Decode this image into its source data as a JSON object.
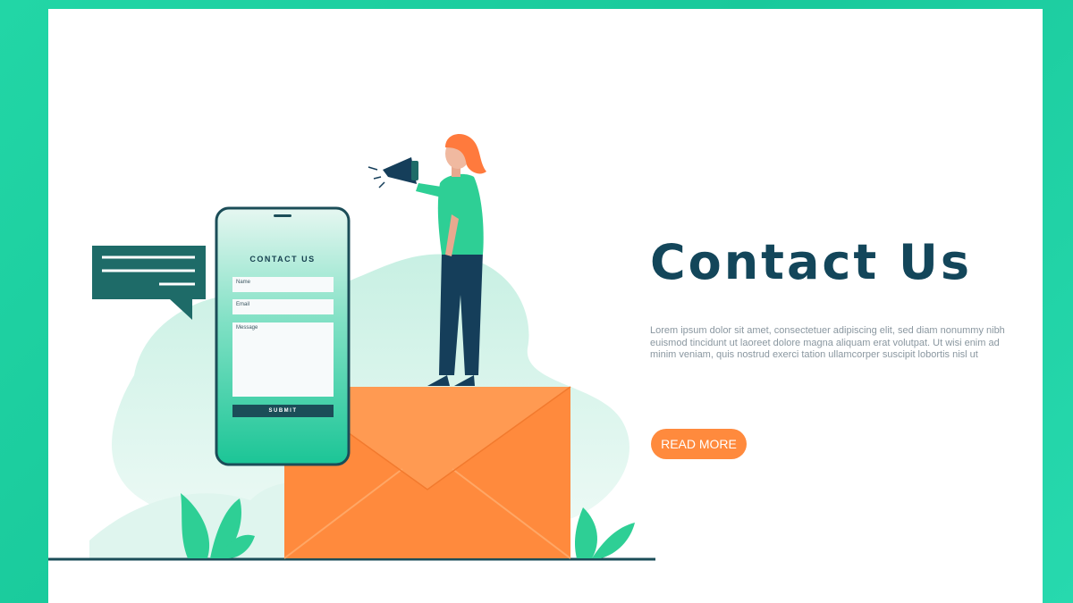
{
  "colors": {
    "frame": "#1fd3a4",
    "heading": "#13465a",
    "accent_orange": "#ff8a3d",
    "phone_gradient_top": "#dff5ee",
    "phone_gradient_bottom": "#1fc89b",
    "dark_teal": "#1b4d58",
    "leaf_green": "#2ecf95"
  },
  "phone": {
    "title": "CONTACT US",
    "name_placeholder": "Name",
    "email_placeholder": "Email",
    "message_placeholder": "Message",
    "submit_label": "SUBMIT"
  },
  "hero": {
    "heading": "Contact Us",
    "body": "Lorem ipsum dolor sit amet, consectetuer adipiscing elit, sed diam nonummy nibh euismod tincidunt ut laoreet dolore magna aliquam erat volutpat. Ut wisi enim ad minim veniam, quis nostrud exerci tation ullamcorper suscipit lobortis nisl ut",
    "cta_label": "READ MORE"
  },
  "icons": {
    "chat": "chat-bubble-icon",
    "megaphone": "megaphone-icon",
    "envelope": "envelope-icon"
  }
}
